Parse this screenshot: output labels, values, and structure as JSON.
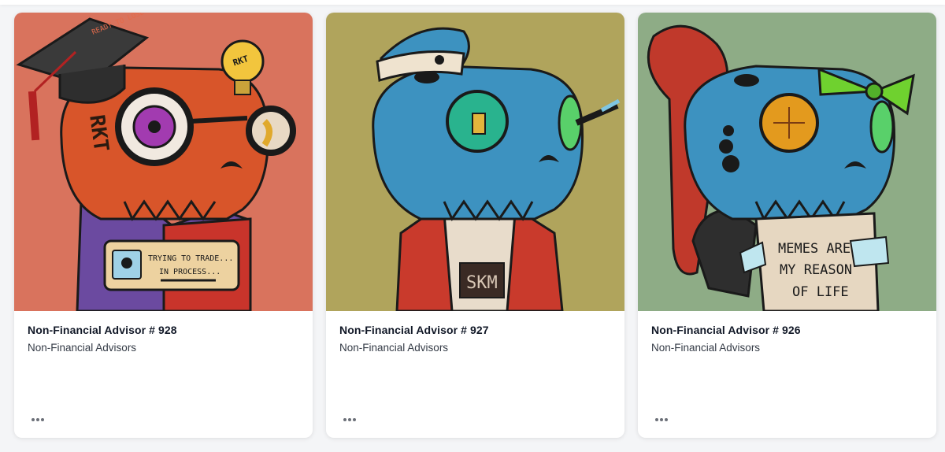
{
  "cards": [
    {
      "title": "Non-Financial Advisor # 928",
      "collection": "Non-Financial Advisors",
      "bg": "#d9735d",
      "skull": "#d8552a",
      "art_text": {
        "cap": "READY TO LOSE MONEY",
        "bulb": "RKT",
        "head": "RKT",
        "sign_line1": "TRYING TO TRADE...",
        "sign_line2": "IN PROCESS..."
      }
    },
    {
      "title": "Non-Financial Advisor # 927",
      "collection": "Non-Financial Advisors",
      "bg": "#b0a45c",
      "skull": "#3d92c0",
      "art_text": {
        "shirt": "SKM"
      }
    },
    {
      "title": "Non-Financial Advisor # 926",
      "collection": "Non-Financial Advisors",
      "bg": "#8eac86",
      "skull": "#3d92c0",
      "art_text": {
        "sign_line1": "MEMES ARE",
        "sign_line2": "MY REASON",
        "sign_line3": "OF LIFE"
      }
    }
  ]
}
